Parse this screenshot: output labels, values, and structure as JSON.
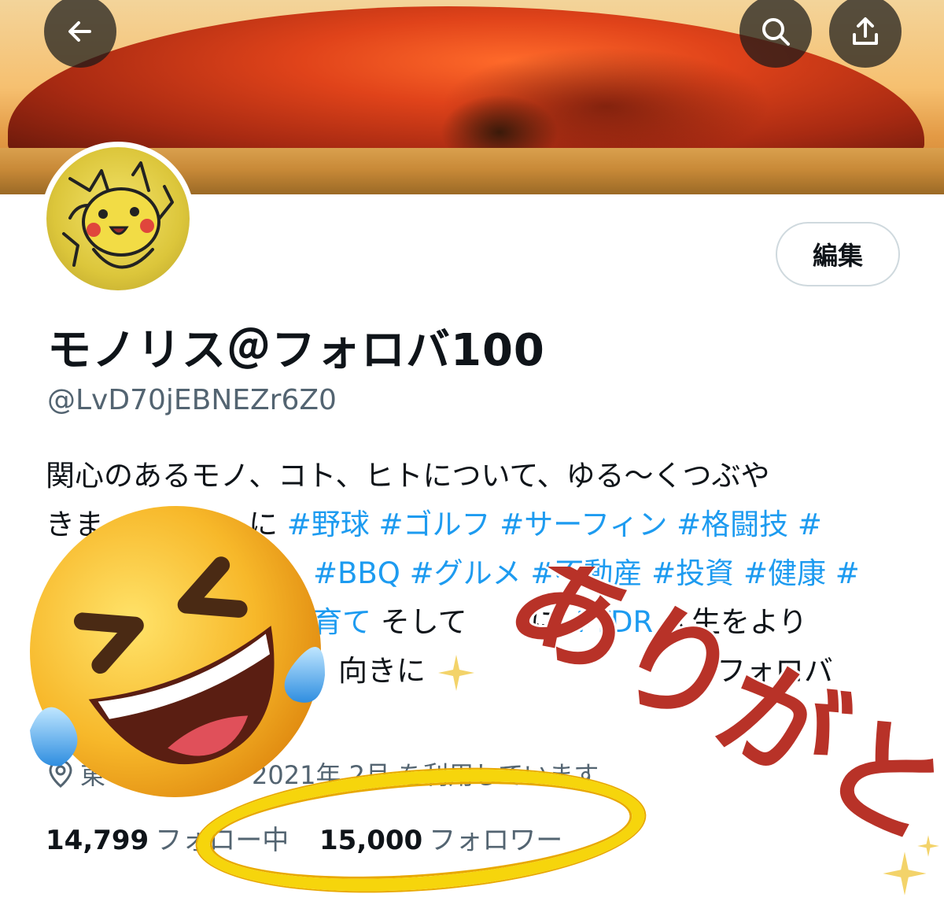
{
  "header": {
    "back_icon": "arrow-left-icon",
    "search_icon": "search-icon",
    "share_icon": "share-icon"
  },
  "profile": {
    "edit_label": "編集",
    "display_name": "モノリス＠フォロバ100",
    "handle": "@LvD70jEBNEZr6Z0",
    "bio": {
      "line1": "関心のあるモノ、コト、ヒトについて、ゆる～くつぶや",
      "line2_pre": "きま",
      "line2_mid": "に ",
      "line2_tags": "#野球 #ゴルフ #サーフィン #格闘技 #",
      "line3_tags": "#BBQ #グルメ #不動産 #投資 #健康 #",
      "line4_tag": "育て",
      "line4_a": " そして",
      "line4_b": "に ",
      "line4_tag2": "#TDR",
      "line4_c": " 人生をより",
      "line5_a": "向きに",
      "line5_b": "フォロバ"
    },
    "meta_text": "2021年 2月  を利用しています",
    "meta_prefix": "東",
    "following_count": "14,799",
    "following_label": "フォロー中",
    "followers_count": "15,000",
    "followers_label": "フォロワー"
  },
  "overlay": {
    "stamp_text": "ありがとう",
    "emoji": "rolling-on-floor-laughing-emoji"
  },
  "colors": {
    "link": "#1d9bf0",
    "secondary_text": "#536471",
    "stamp_red": "#b83228",
    "ring_yellow": "#f6d50c"
  }
}
